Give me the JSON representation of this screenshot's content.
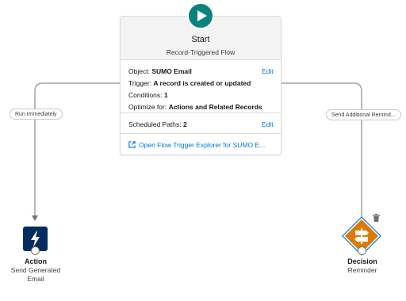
{
  "start": {
    "title": "Start",
    "subtitle": "Record-Triggered Flow",
    "object_label": "Object:",
    "object_value": "SUMO Email",
    "trigger_label": "Trigger:",
    "trigger_value": "A record is created or updated",
    "conditions_label": "Conditions:",
    "conditions_value": "1",
    "optimize_label": "Optimize for:",
    "optimize_value": "Actions and Related Records",
    "edit_label": "Edit",
    "scheduled_label": "Scheduled Paths:",
    "scheduled_value": "2",
    "scheduled_edit_label": "Edit",
    "explorer_link": "Open Flow Trigger Explorer for SUMO E..."
  },
  "paths": {
    "left_label": "Run Immediately",
    "right_label": "Send Additional Remind..."
  },
  "action_node": {
    "title": "Action",
    "subtitle_line1": "Send Generated",
    "subtitle_line2": "Email",
    "icon": "lightning-bolt-icon"
  },
  "decision_node": {
    "title": "Decision",
    "subtitle": "Reminder",
    "icon": "decision-signpost-icon"
  },
  "colors": {
    "start_teal": "#0b827c",
    "action_navy": "#032d60",
    "decision_orange": "#dd7a01",
    "link_blue": "#0176d3",
    "connector_gray": "#939393"
  }
}
